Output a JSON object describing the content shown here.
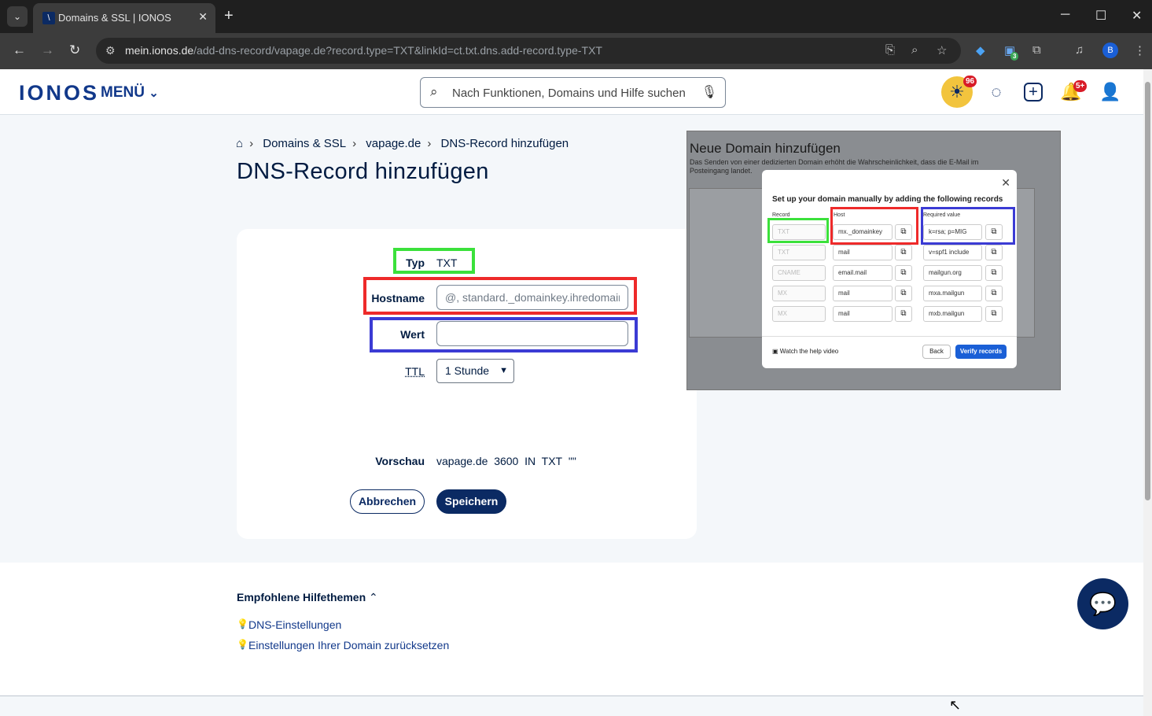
{
  "browser": {
    "tab_title": "Domains & SSL | IONOS",
    "url_domain": "mein.ionos.de",
    "url_path": "/add-dns-record/vapage.de?record.type=TXT&linkId=ct.txt.dns.add-record.type-TXT",
    "profile_initial": "B",
    "extension_badge": "3"
  },
  "header": {
    "logo": "IONOS",
    "menu_label": "MENÜ",
    "search_placeholder": "Nach Funktionen, Domains und Hilfe suchen",
    "sun_badge": "96",
    "notifications_badge": "5+"
  },
  "breadcrumb": [
    "Domains & SSL",
    "vapage.de",
    "DNS-Record hinzufügen"
  ],
  "page_title": "DNS-Record hinzufügen",
  "form": {
    "typ_label": "Typ",
    "typ_value": "TXT",
    "hostname_label": "Hostname",
    "hostname_placeholder": "@, standard._domainkey.ihredomain.de",
    "hostname_value": "",
    "wert_label": "Wert",
    "wert_value": "",
    "ttl_label": "TTL",
    "ttl_selected": "1 Stunde",
    "preview_label": "Vorschau",
    "preview_domain": "vapage.de",
    "preview_ttl": "3600",
    "preview_class": "IN",
    "preview_type": "TXT",
    "preview_value": "\"\"",
    "cancel_label": "Abbrechen",
    "save_label": "Speichern"
  },
  "screenshot": {
    "bg_title": "Neue Domain hinzufügen",
    "bg_subtitle": "Das Senden von einer dedizierten Domain erhöht die Wahrscheinlichkeit, dass die E-Mail im Posteingang landet.",
    "modal_title": "Set up your domain manually by adding the following records",
    "col_record": "Record",
    "col_host": "Host",
    "col_value": "Required value",
    "rows": [
      {
        "record": "TXT",
        "host": "mx._domainkey",
        "value": "k=rsa; p=MIG"
      },
      {
        "record": "TXT",
        "host": "mail",
        "value": "v=spf1 include"
      },
      {
        "record": "CNAME",
        "host": "email.mail",
        "value": "mailgun.org"
      },
      {
        "record": "MX",
        "host": "mail",
        "value": "mxa.mailgun"
      },
      {
        "record": "MX",
        "host": "mail",
        "value": "mxb.mailgun"
      }
    ],
    "watch_label": "Watch the help video",
    "back_label": "Back",
    "verify_label": "Verify records"
  },
  "help": {
    "title": "Empfohlene Hilfethemen",
    "links": [
      "DNS-Einstellungen",
      "Einstellungen Ihrer Domain zurücksetzen"
    ]
  },
  "colors": {
    "highlight_green": "#3be13b",
    "highlight_red": "#ee2a2a",
    "highlight_blue": "#3b3bd4",
    "brand_navy": "#0b2a63"
  }
}
